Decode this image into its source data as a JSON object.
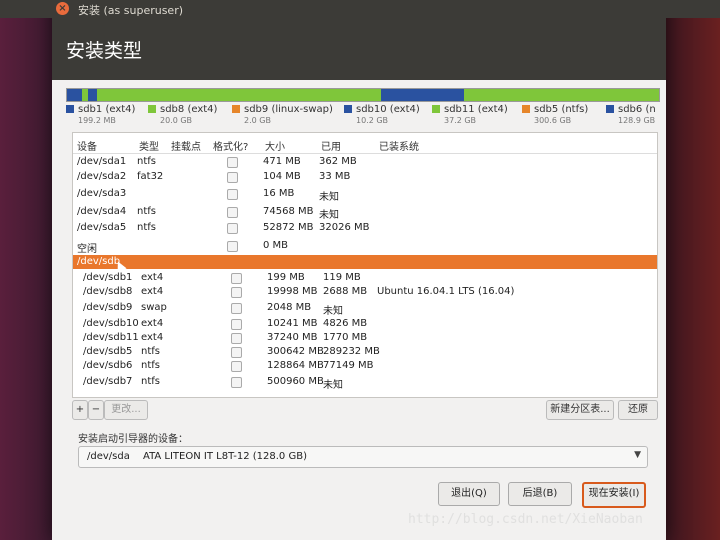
{
  "window": {
    "title": "安装 (as superuser)",
    "close_icon": "close-icon"
  },
  "page_title": "安装类型",
  "partition_bar": {
    "segments": [
      {
        "color": "#2a52a0",
        "value": 2.5
      },
      {
        "color": "#7fc63a",
        "value": 1.0
      },
      {
        "color": "#2a52a0",
        "value": 1.5
      },
      {
        "color": "#7fc63a",
        "value": 48
      },
      {
        "color": "#2a52a0",
        "value": 14
      },
      {
        "color": "#7fc63a",
        "value": 33
      }
    ]
  },
  "legend": [
    {
      "label": "sdb1 (ext4)",
      "size": "199.2 MB",
      "color": "#2a52a0"
    },
    {
      "label": "sdb8 (ext4)",
      "size": "20.0 GB",
      "color": "#7fc63a"
    },
    {
      "label": "sdb9 (linux-swap)",
      "size": "2.0 GB",
      "color": "#e6862a"
    },
    {
      "label": "sdb10 (ext4)",
      "size": "10.2 GB",
      "color": "#2a52a0"
    },
    {
      "label": "sdb11 (ext4)",
      "size": "37.2 GB",
      "color": "#7fc63a"
    },
    {
      "label": "sdb5 (ntfs)",
      "size": "300.6 GB",
      "color": "#e6862a"
    },
    {
      "label": "sdb6 (n",
      "size": "128.9 GB",
      "color": "#2a52a0"
    }
  ],
  "table": {
    "headers": [
      "设备",
      "类型",
      "挂载点",
      "格式化?",
      "大小",
      "已用",
      "已装系统"
    ],
    "rows": [
      {
        "device": "/dev/sda1",
        "type": "ntfs",
        "size": "471 MB",
        "used": "362 MB",
        "system": ""
      },
      {
        "device": "/dev/sda2",
        "type": "fat32",
        "size": "104 MB",
        "used": "33 MB",
        "system": ""
      },
      {
        "device": "/dev/sda3",
        "type": "",
        "size": "16 MB",
        "used": "未知",
        "system": ""
      },
      {
        "device": "/dev/sda4",
        "type": "ntfs",
        "size": "74568 MB",
        "used": "未知",
        "system": ""
      },
      {
        "device": "/dev/sda5",
        "type": "ntfs",
        "size": "52872 MB",
        "used": "32026 MB",
        "system": ""
      },
      {
        "device": "空闲",
        "type": "",
        "size": "0 MB",
        "used": "",
        "system": ""
      },
      {
        "device": "/dev/sdb",
        "type": "",
        "size": "",
        "used": "",
        "system": "",
        "selected": true
      },
      {
        "device": "/dev/sdb1",
        "type": "ext4",
        "size": "199 MB",
        "used": "119 MB",
        "system": ""
      },
      {
        "device": "/dev/sdb8",
        "type": "ext4",
        "size": "19998 MB",
        "used": "2688 MB",
        "system": "Ubuntu 16.04.1 LTS (16.04)"
      },
      {
        "device": "/dev/sdb9",
        "type": "swap",
        "size": "2048 MB",
        "used": "未知",
        "system": ""
      },
      {
        "device": "/dev/sdb10",
        "type": "ext4",
        "size": "10241 MB",
        "used": "4826 MB",
        "system": ""
      },
      {
        "device": "/dev/sdb11",
        "type": "ext4",
        "size": "37240 MB",
        "used": "1770 MB",
        "system": ""
      },
      {
        "device": "/dev/sdb5",
        "type": "ntfs",
        "size": "300642 MB",
        "used": "289232 MB",
        "system": ""
      },
      {
        "device": "/dev/sdb6",
        "type": "ntfs",
        "size": "128864 MB",
        "used": "77149 MB",
        "system": ""
      },
      {
        "device": "/dev/sdb7",
        "type": "ntfs",
        "size": "500960 MB",
        "used": "未知",
        "system": ""
      }
    ]
  },
  "toolbar": {
    "add": "+",
    "remove": "−",
    "change": "更改...",
    "new_table": "新建分区表...",
    "revert": "还原"
  },
  "boot_loader": {
    "label": "安装启动引导器的设备：",
    "device": "/dev/sda",
    "desc": "ATA LITEON IT L8T-12 (128.0 GB)"
  },
  "actions": {
    "quit": "退出(Q)",
    "back": "后退(B)",
    "install": "现在安装(I)"
  },
  "watermark": "http://blog.csdn.net/XieNaoban"
}
